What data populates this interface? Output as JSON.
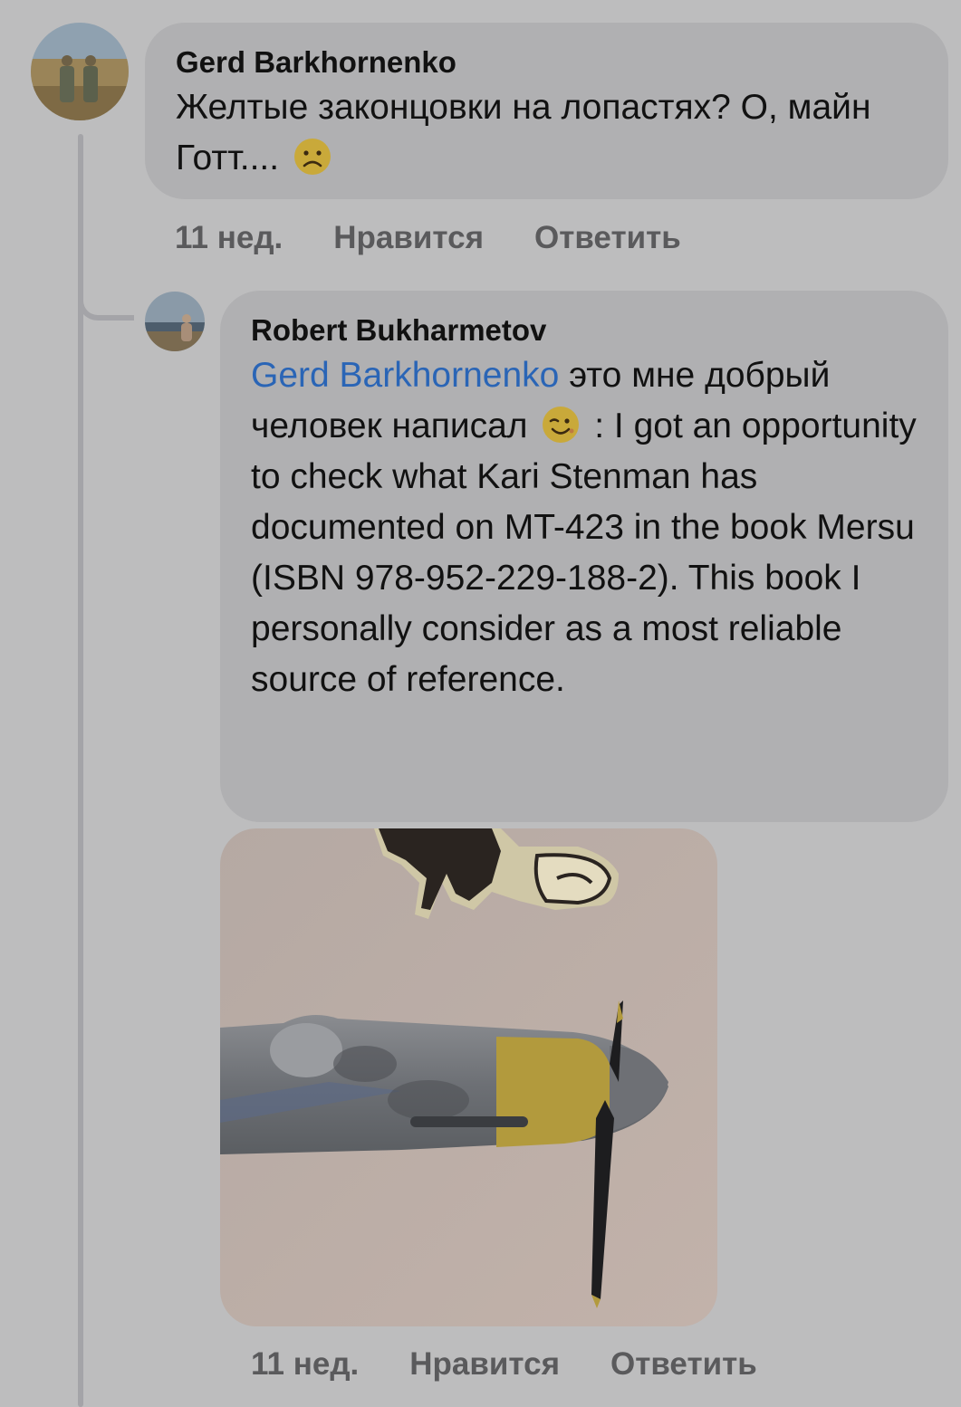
{
  "comments": [
    {
      "author": "Gerd Barkhornenko",
      "text": "Желтые законцовки на лопастях? О, майн Готт....",
      "emoji": "slightly-frowning-face-icon",
      "time": "11 нед.",
      "like_label": "Нравится",
      "reply_label": "Ответить"
    },
    {
      "author": "Robert Bukharmetov",
      "mention": "Gerd Barkhornenko",
      "text_part1": " это мне добрый человек написал ",
      "emoji": "winking-face-icon",
      "text_part2": " :  I got an opportunity to check what Kari Stenman has documented on MT-423 in the book Mersu (ISBN 978-952-229-188-2). This book I personally consider as a most reliable source of reference.",
      "time": "11 нед.",
      "like_label": "Нравится",
      "reply_label": "Ответить",
      "attachment": "aircraft-illustration-photo"
    }
  ]
}
